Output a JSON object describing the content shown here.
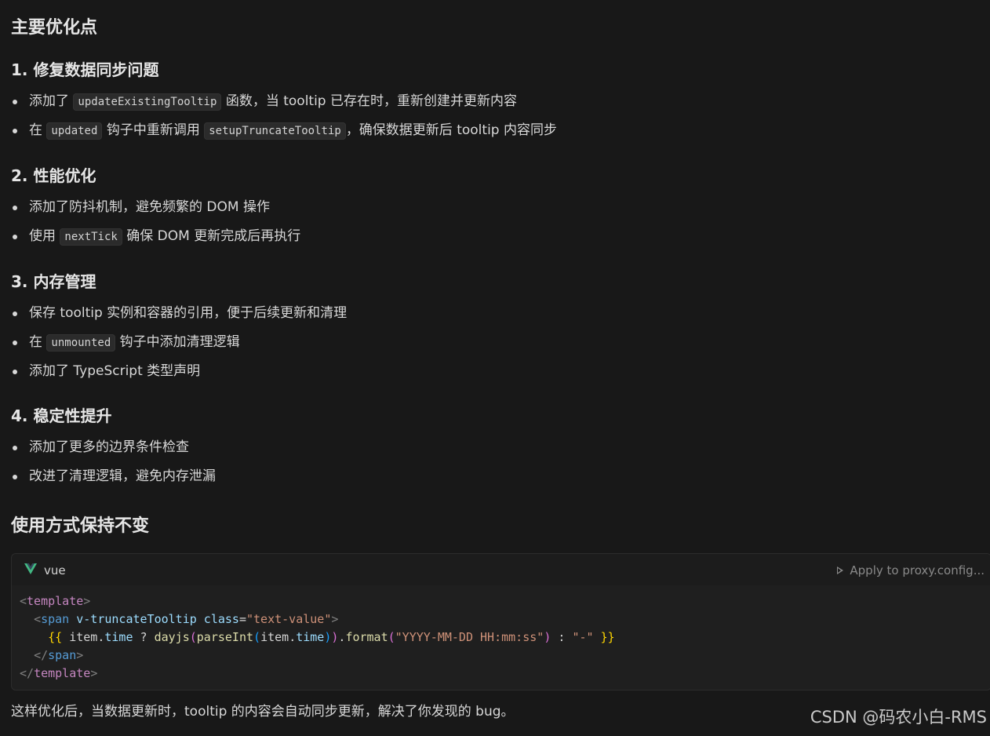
{
  "title": "主要优化点",
  "sections": [
    {
      "heading": "1. 修复数据同步问题",
      "items": [
        {
          "pre": "添加了 ",
          "code": "updateExistingTooltip",
          "post": " 函数，当 tooltip 已存在时，重新创建并更新内容"
        },
        {
          "pre": "在 ",
          "code": "updated",
          "mid": " 钩子中重新调用 ",
          "code2": "setupTruncateTooltip",
          "post": "，确保数据更新后 tooltip 内容同步"
        }
      ]
    },
    {
      "heading": "2. 性能优化",
      "items": [
        {
          "pre": "添加了防抖机制，避免频繁的 DOM 操作"
        },
        {
          "pre": "使用 ",
          "code": "nextTick",
          "post": " 确保 DOM 更新完成后再执行"
        }
      ]
    },
    {
      "heading": "3. 内存管理",
      "items": [
        {
          "pre": "保存 tooltip 实例和容器的引用，便于后续更新和清理"
        },
        {
          "pre": "在 ",
          "code": "unmounted",
          "post": " 钩子中添加清理逻辑"
        },
        {
          "pre": "添加了 TypeScript 类型声明"
        }
      ]
    },
    {
      "heading": "4. 稳定性提升",
      "items": [
        {
          "pre": "添加了更多的边界条件检查"
        },
        {
          "pre": "改进了清理逻辑，避免内存泄漏"
        }
      ]
    }
  ],
  "usage_heading": "使用方式保持不变",
  "code_block": {
    "language": "vue",
    "language_icon": "vue-logo-icon",
    "apply_label": "Apply to proxy.config...",
    "lines": {
      "l1_open": "<",
      "l1_tag": "template",
      "l1_close": ">",
      "l2_indent": "  ",
      "l2_open": "<",
      "l2_tag": "span",
      "l2_attr1": " v-truncateTooltip",
      "l2_attr2": " class",
      "l2_eq": "=",
      "l2_str": "\"text-value\"",
      "l2_close": ">",
      "l3_indent": "    ",
      "l3_lbrace": "{{",
      "l3_sp1": " ",
      "l3_item": "item",
      "l3_dot": ".",
      "l3_time": "time",
      "l3_q": " ? ",
      "l3_dayjs": "dayjs",
      "l3_p1": "(",
      "l3_parseInt": "parseInt",
      "l3_p2": "(",
      "l3_item2": "item",
      "l3_dot2": ".",
      "l3_time2": "time",
      "l3_p3": ")",
      "l3_p4": ")",
      "l3_dot3": ".",
      "l3_format": "format",
      "l3_p5": "(",
      "l3_fmtstr": "\"YYYY-MM-DD HH:mm:ss\"",
      "l3_p6": ")",
      "l3_colon": " : ",
      "l3_dash": "\"-\"",
      "l3_sp2": " ",
      "l3_rbrace": "}}",
      "l4_indent": "  ",
      "l4_open": "</",
      "l4_tag": "span",
      "l4_close": ">",
      "l5_open": "</",
      "l5_tag": "template",
      "l5_close": ">"
    }
  },
  "footer_text": "这样优化后，当数据更新时，tooltip 的内容会自动同步更新，解决了你发现的 bug。",
  "watermark": "CSDN @码农小白-RMS",
  "colors": {
    "background": "#181818",
    "text": "#d8d8d8",
    "vue_green": "#42b883"
  }
}
